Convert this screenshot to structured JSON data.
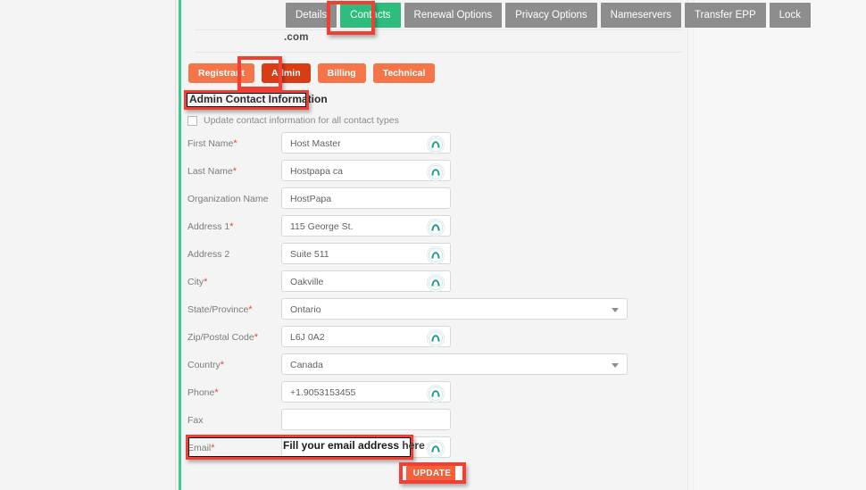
{
  "window": {
    "background": "#f2f2f2",
    "panel_accent": "#3ec98a"
  },
  "top_tabs": {
    "active_color": "#2fbd7d",
    "inactive_color": "#8d8d8d",
    "items": [
      {
        "label": "Details",
        "active": false
      },
      {
        "label": "Contacts",
        "active": true
      },
      {
        "label": "Renewal Options",
        "active": false
      },
      {
        "label": "Privacy Options",
        "active": false
      },
      {
        "label": "Nameservers",
        "active": false
      },
      {
        "label": "Transfer EPP",
        "active": false
      },
      {
        "label": "Lock",
        "active": false
      }
    ]
  },
  "domain": {
    "name": ".com"
  },
  "sub_tabs": {
    "active_color": "#d93d16",
    "inactive_color": "#f4754a",
    "items": [
      {
        "label": "Registrant",
        "active": false
      },
      {
        "label": "Admin",
        "active": true
      },
      {
        "label": "Billing",
        "active": false
      },
      {
        "label": "Technical",
        "active": false
      }
    ]
  },
  "section": {
    "title": "Admin Contact Information"
  },
  "bulk_update": {
    "label": "Update contact information for all contact types",
    "checked": false
  },
  "form": {
    "fields": [
      {
        "label": "First Name",
        "required": true,
        "type": "text",
        "value": "Host Master",
        "width": "narrow",
        "autofill_icon": true
      },
      {
        "label": "Last Name",
        "required": true,
        "type": "text",
        "value": "Hostpapa ca",
        "width": "narrow",
        "autofill_icon": true
      },
      {
        "label": "Organization Name",
        "required": false,
        "type": "text",
        "value": "HostPapa",
        "width": "narrow",
        "autofill_icon": false
      },
      {
        "label": "Address 1",
        "required": true,
        "type": "text",
        "value": "115 George St.",
        "width": "narrow",
        "autofill_icon": true
      },
      {
        "label": "Address 2",
        "required": false,
        "type": "text",
        "value": "Suite 511",
        "width": "narrow",
        "autofill_icon": true
      },
      {
        "label": "City",
        "required": true,
        "type": "text",
        "value": "Oakville",
        "width": "narrow",
        "autofill_icon": true
      },
      {
        "label": "State/Province",
        "required": true,
        "type": "select",
        "value": "Ontario",
        "width": "wide",
        "autofill_icon": false
      },
      {
        "label": "Zip/Postal Code",
        "required": true,
        "type": "text",
        "value": "L6J 0A2",
        "width": "narrow",
        "autofill_icon": true
      },
      {
        "label": "Country",
        "required": true,
        "type": "select",
        "value": "Canada",
        "width": "wide",
        "autofill_icon": false
      },
      {
        "label": "Phone",
        "required": true,
        "type": "text",
        "value": "+1.9053153455",
        "width": "narrow",
        "autofill_icon": true
      },
      {
        "label": "Fax",
        "required": false,
        "type": "text",
        "value": "",
        "width": "narrow",
        "autofill_icon": false
      },
      {
        "label": "Email",
        "required": true,
        "type": "text",
        "value": "",
        "width": "narrow",
        "autofill_icon": true
      }
    ]
  },
  "actions": {
    "update_label": "UPDATE",
    "update_color": "#f4603c"
  },
  "annotations": {
    "highlight_color": "#ef4034",
    "email_callout_bold": "Fill your email address",
    "email_callout_light": " here"
  },
  "icons": {
    "autofill": "password-manager-arch-icon",
    "select_caret": "chevron-down-icon",
    "checkbox": "checkbox-icon"
  }
}
